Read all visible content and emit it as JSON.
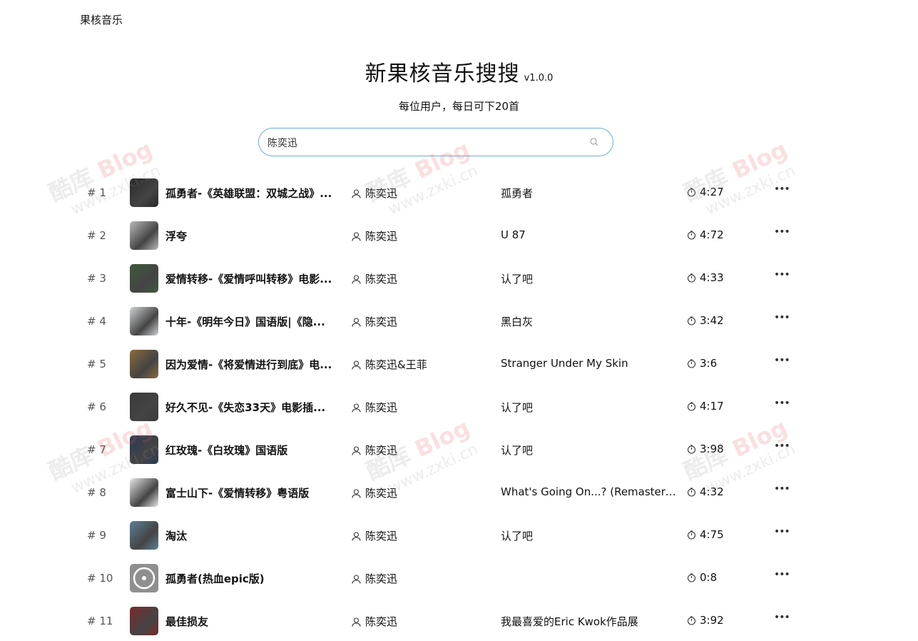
{
  "header": {
    "brand": "果核音乐",
    "title": "新果核音乐搜搜",
    "version": "v1.0.0",
    "subtitle": "每位用户，每日可下20首"
  },
  "search": {
    "value": "陈奕迅"
  },
  "watermark": {
    "line1_a": "酷库",
    "line1_b": "Blog",
    "line2": "www.zxki.cn"
  },
  "tracks": [
    {
      "index": "# 1",
      "title": "孤勇者-《英雄联盟：双城之战》...",
      "artist": "陈奕迅",
      "album": "孤勇者",
      "duration": "4:27",
      "cover": "#2a2a2a"
    },
    {
      "index": "# 2",
      "title": "浮夸",
      "artist": "陈奕迅",
      "album": "U 87",
      "duration": "4:72",
      "cover": "#b9b9b9"
    },
    {
      "index": "# 3",
      "title": "爱情转移-《爱情呼叫转移》电影...",
      "artist": "陈奕迅",
      "album": "认了吧",
      "duration": "4:33",
      "cover": "#3d5a3a"
    },
    {
      "index": "# 4",
      "title": "十年-《明年今日》国语版|《隐...",
      "artist": "陈奕迅",
      "album": "黑白灰",
      "duration": "3:42",
      "cover": "#cfd3d4"
    },
    {
      "index": "# 5",
      "title": "因为爱情-《将爱情进行到底》电...",
      "artist": "陈奕迅&王菲",
      "album": "Stranger Under My Skin",
      "duration": "3:6",
      "cover": "#8a6a3a"
    },
    {
      "index": "# 6",
      "title": "好久不见-《失恋33天》电影插...",
      "artist": "陈奕迅",
      "album": "认了吧",
      "duration": "4:17",
      "cover": "#3a3a3a"
    },
    {
      "index": "# 7",
      "title": "红玫瑰-《白玫瑰》国语版",
      "artist": "陈奕迅",
      "album": "认了吧",
      "duration": "3:98",
      "cover": "#2b3a55"
    },
    {
      "index": "# 8",
      "title": "富士山下-《爱情转移》粤语版",
      "artist": "陈奕迅",
      "album": "What's Going On...? (Remastere...",
      "duration": "4:32",
      "cover": "#e6e6e6"
    },
    {
      "index": "# 9",
      "title": "淘汰",
      "artist": "陈奕迅",
      "album": "认了吧",
      "duration": "4:75",
      "cover": "#5c7f95"
    },
    {
      "index": "# 10",
      "title": "孤勇者(热血epic版)",
      "artist": "陈奕迅",
      "album": "",
      "duration": "0:8",
      "cover": "#8f8f8f"
    },
    {
      "index": "# 11",
      "title": "最佳损友",
      "artist": "陈奕迅",
      "album": "我最喜爱的Eric Kwok作品展",
      "duration": "3:92",
      "cover": "#7a2a2a"
    }
  ]
}
